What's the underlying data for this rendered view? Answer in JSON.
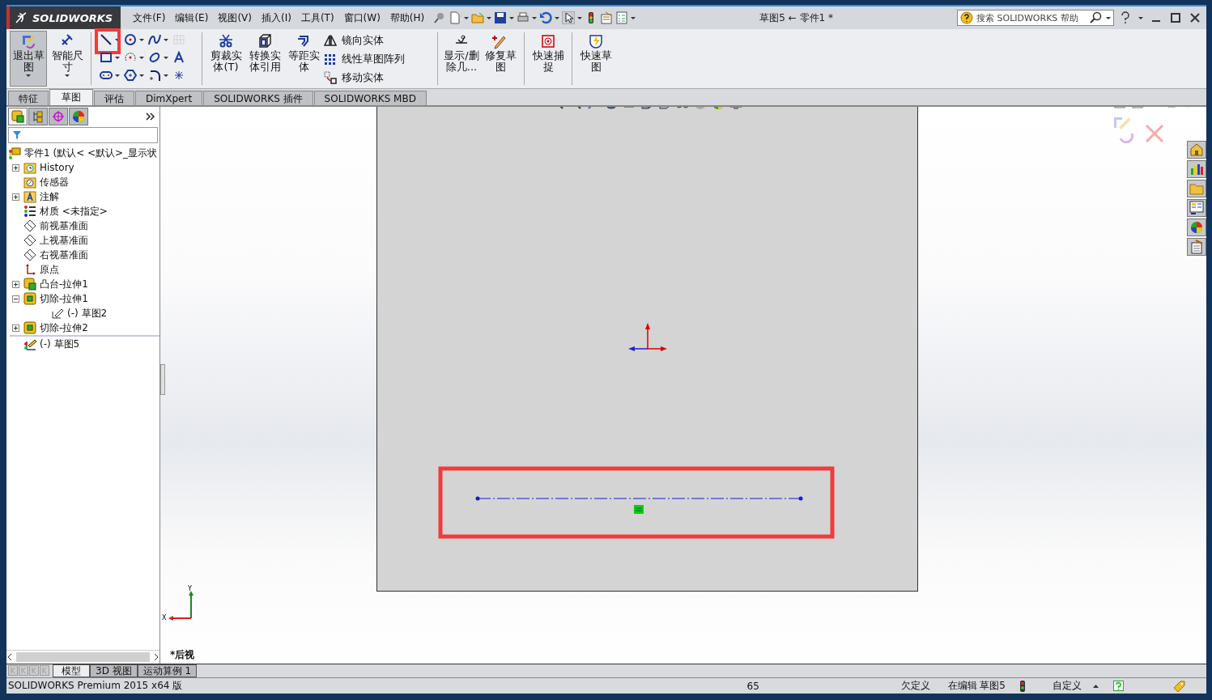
{
  "window": {
    "logo": "SOLIDWORKS",
    "title": "草图5 ← 零件1 *"
  },
  "menu": [
    {
      "label": "文件(F)"
    },
    {
      "label": "编辑(E)"
    },
    {
      "label": "视图(V)"
    },
    {
      "label": "插入(I)"
    },
    {
      "label": "工具(T)"
    },
    {
      "label": "窗口(W)"
    },
    {
      "label": "帮助(H)"
    }
  ],
  "search": {
    "placeholder": "搜索 SOLIDWORKS 帮助"
  },
  "ribbon": {
    "large_tools": [
      {
        "label": "退出草图",
        "kind": "exit-sketch",
        "selected": true
      },
      {
        "label": "智能尺寸",
        "kind": "dimension",
        "selected": false
      }
    ],
    "sketch_tools": [
      {
        "kind": "line",
        "highlighted": true
      },
      {
        "kind": "circle",
        "highlighted": false
      },
      {
        "kind": "spline",
        "highlighted": false
      },
      {
        "kind": "grid",
        "highlighted": false
      },
      {
        "kind": "rectangle",
        "highlighted": false
      },
      {
        "kind": "arc",
        "highlighted": false
      },
      {
        "kind": "ellipse",
        "highlighted": false
      },
      {
        "kind": "text",
        "highlighted": false
      },
      {
        "kind": "slot",
        "highlighted": false
      },
      {
        "kind": "polygon",
        "highlighted": false
      },
      {
        "kind": "fillet",
        "highlighted": false
      },
      {
        "kind": "point",
        "highlighted": false
      }
    ],
    "commands": [
      {
        "label": "剪裁实体(T)",
        "kind": "trim"
      },
      {
        "label": "转换实体引用",
        "kind": "convert"
      },
      {
        "label": "等距实体",
        "kind": "offset"
      }
    ],
    "list_commands": [
      {
        "label": "镜向实体",
        "kind": "mirror"
      },
      {
        "label": "线性草图阵列",
        "kind": "pattern"
      },
      {
        "label": "移动实体",
        "kind": "move"
      }
    ],
    "extra_commands": [
      {
        "label": "显示/删除几...",
        "kind": "relations"
      },
      {
        "label": "修复草图",
        "kind": "repair"
      },
      {
        "label": "快速捕捉",
        "kind": "snap"
      },
      {
        "label": "快速草图",
        "kind": "rapid"
      }
    ]
  },
  "tabs": [
    {
      "label": "特征",
      "selected": false
    },
    {
      "label": "草图",
      "selected": true
    },
    {
      "label": "评估",
      "selected": false
    },
    {
      "label": "DimXpert",
      "selected": false
    },
    {
      "label": "SOLIDWORKS 插件",
      "selected": false
    },
    {
      "label": "SOLIDWORKS MBD",
      "selected": false
    }
  ],
  "panel_tabs": [
    {
      "kind": "feature-tree",
      "selected": true
    },
    {
      "kind": "property",
      "selected": false
    },
    {
      "kind": "configuration",
      "selected": false
    },
    {
      "kind": "appearance",
      "selected": false
    }
  ],
  "feature_tree": {
    "items": [
      {
        "label": "零件1  (默认< <默认>_显示状",
        "kind": "part",
        "children": [
          {
            "label": "History",
            "kind": "history",
            "expanded": false
          },
          {
            "label": "传感器",
            "kind": "sensor"
          },
          {
            "label": "注解",
            "kind": "annotation",
            "expanded": false
          },
          {
            "label": "材质 <未指定>",
            "kind": "material"
          },
          {
            "label": "前视基准面",
            "kind": "plane"
          },
          {
            "label": "上视基准面",
            "kind": "plane"
          },
          {
            "label": "右视基准面",
            "kind": "plane"
          },
          {
            "label": "原点",
            "kind": "origin"
          },
          {
            "label": "凸台-拉伸1",
            "kind": "boss",
            "expanded": false
          },
          {
            "label": "切除-拉伸1",
            "kind": "cut",
            "expanded": true,
            "children": [
              {
                "label": "(-) 草图2",
                "kind": "sketch"
              }
            ]
          },
          {
            "label": "切除-拉伸2",
            "kind": "cut",
            "expanded": false
          },
          {
            "label": "(-) 草图5",
            "kind": "active-sketch"
          }
        ]
      }
    ]
  },
  "viewport": {
    "view_label": "*后视",
    "triad": {
      "x_label": "X",
      "y_label": "Y"
    },
    "sketch": {
      "highlighted": true
    }
  },
  "model_tabs": [
    {
      "label": "模型",
      "selected": true
    },
    {
      "label": "3D 视图",
      "selected": false
    },
    {
      "label": "运动算例 1",
      "selected": false
    }
  ],
  "status_bar": {
    "product": "SOLIDWORKS Premium 2015 x64 版",
    "coordinate": "65",
    "state": "欠定义",
    "editing": "在编辑 草图5",
    "units": "自定义"
  }
}
